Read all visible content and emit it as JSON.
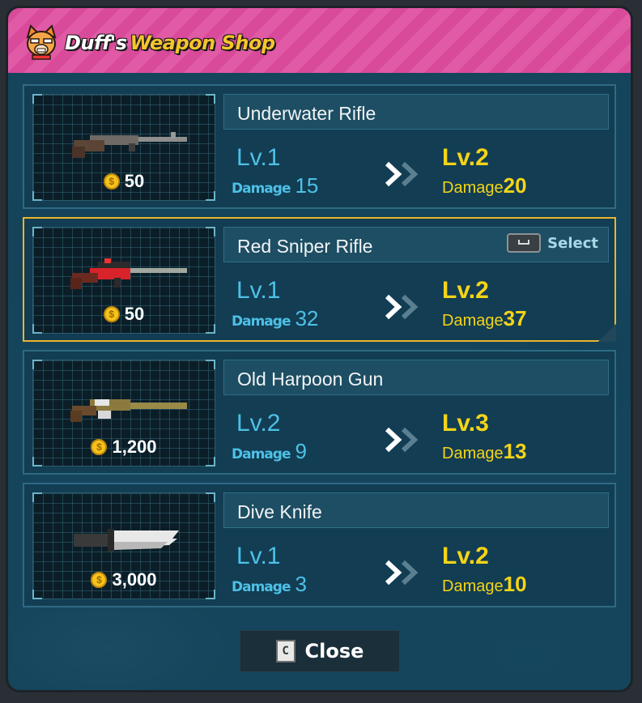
{
  "header": {
    "title_part1": "Duff's",
    "title_part2": "Weapon Shop"
  },
  "items": [
    {
      "name": "Underwater Rifle",
      "price": "50",
      "current_level": "Lv.1",
      "current_damage_label": "Damage",
      "current_damage": "15",
      "next_level": "Lv.2",
      "next_damage_label": "Damage",
      "next_damage": "20",
      "selected": false,
      "weapon_icon": "rifle-icon"
    },
    {
      "name": "Red Sniper Rifle",
      "price": "50",
      "current_level": "Lv.1",
      "current_damage_label": "Damage",
      "current_damage": "32",
      "next_level": "Lv.2",
      "next_damage_label": "Damage",
      "next_damage": "37",
      "selected": true,
      "select_label": "Select",
      "weapon_icon": "sniper-rifle-icon"
    },
    {
      "name": "Old Harpoon Gun",
      "price": "1,200",
      "current_level": "Lv.2",
      "current_damage_label": "Damage",
      "current_damage": "9",
      "next_level": "Lv.3",
      "next_damage_label": "Damage",
      "next_damage": "13",
      "selected": false,
      "weapon_icon": "harpoon-gun-icon"
    },
    {
      "name": "Dive Knife",
      "price": "3,000",
      "current_level": "Lv.1",
      "current_damage_label": "Damage",
      "current_damage": "3",
      "next_level": "Lv.2",
      "next_damage_label": "Damage",
      "next_damage": "10",
      "selected": false,
      "weapon_icon": "knife-icon"
    }
  ],
  "close_button": {
    "key": "C",
    "label": "Close"
  },
  "colors": {
    "header": "#d94a9a",
    "accent_gold": "#f4d418",
    "current_blue": "#4ec0e6",
    "selected_border": "#e9b52c"
  }
}
